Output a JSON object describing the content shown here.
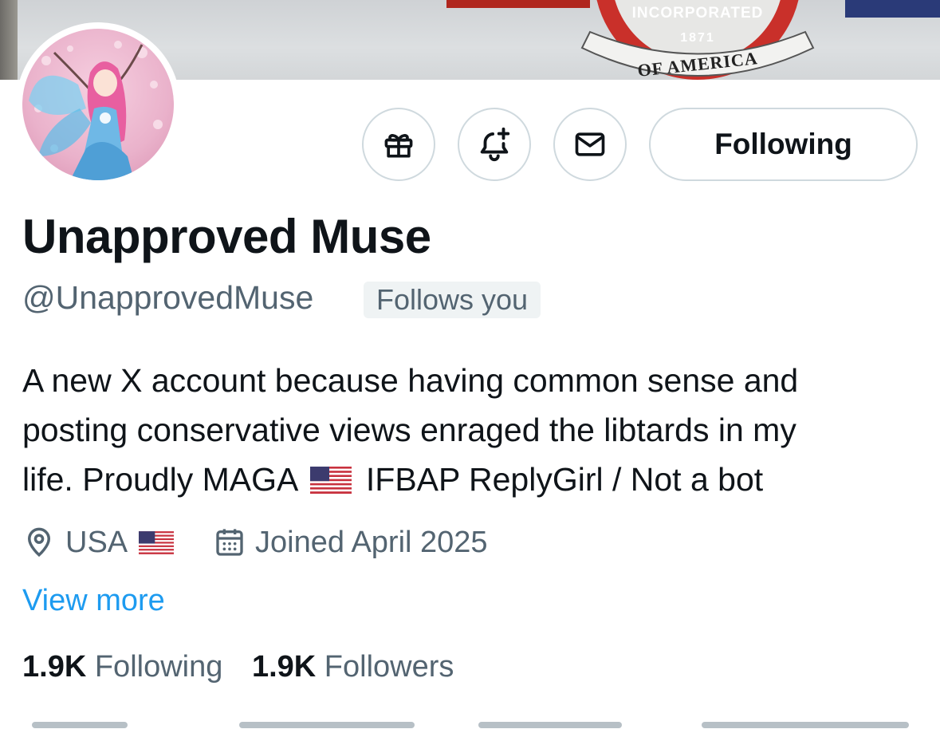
{
  "banner": {
    "seal_top_text": "INCORPORATED",
    "seal_year": "1871",
    "seal_ribbon": "OF AMERICA"
  },
  "actions": {
    "gift_icon": "gift-icon",
    "notify_icon": "bell-plus-icon",
    "message_icon": "envelope-icon",
    "follow_label": "Following"
  },
  "profile": {
    "display_name": "Unapproved Muse",
    "handle": "@UnapprovedMuse",
    "follows_you": "Follows you",
    "bio_line1": "A new X account because having common sense and",
    "bio_line2": "posting conservative views enraged the libtards in my",
    "bio_line3a": "life. Proudly MAGA",
    "bio_line3b": "IFBAP ReplyGirl / Not a bot",
    "location": "USA",
    "joined": "Joined April 2025",
    "view_more": "View more"
  },
  "stats": {
    "following_count": "1.9K",
    "following_label": "Following",
    "followers_count": "1.9K",
    "followers_label": "Followers"
  },
  "colors": {
    "accent": "#1d9bf0",
    "secondary_text": "#536471",
    "border": "#cfd9de"
  }
}
